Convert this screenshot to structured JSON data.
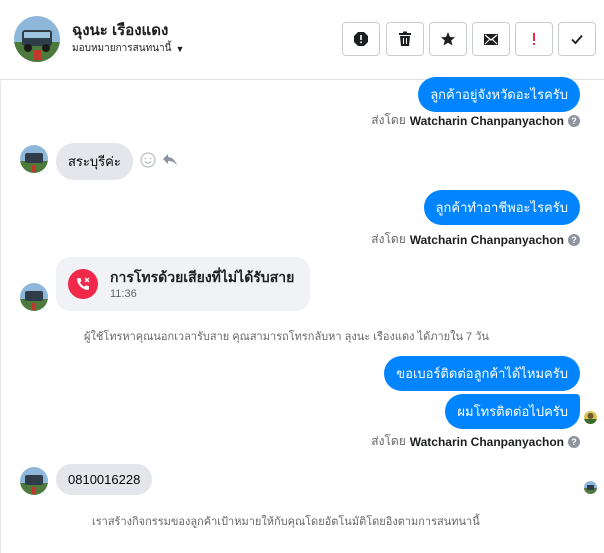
{
  "header": {
    "name": "ฉุงนะ เรืองแดง",
    "assign_label": "มอบหมายการสนทนานี้",
    "actions": [
      "report-icon",
      "trash-icon",
      "star-icon",
      "mark-unread-icon",
      "important-icon",
      "done-icon"
    ]
  },
  "messages": {
    "out_1": "ลูกค้าอยู่จังหวัดอะไรครับ",
    "sentby_prefix": "ส่งโดย",
    "agent_name": "Watcharin Chanpanyachon",
    "in_1": "สระบุรีค่ะ",
    "out_2": "ลูกค้าทำอาชีพอะไรครับ",
    "call_title": "การโทรด้วยเสียงที่ไม่ได้รับสาย",
    "call_time": "11:36",
    "call_notice": "ผู้ใช้โทรหาคุณนอกเวลารับสาย คุณสามารถโทรกลับหา ลุงนะ เรืองแดง ได้ภายใน 7 วัน",
    "out_3": "ขอเบอร์ติดต่อลูกค้าได้ไหมครับ",
    "out_4": "ผมโทรติดต่อไปครับ",
    "in_2": "0810016228",
    "activity_notice": "เราสร้างกิจกรรมของลูกค้าเป้าหมายให้กับคุณโดยอัตโนมัติโดยอิงตามการสนทนานี้"
  },
  "colors": {
    "accent": "#0084ff",
    "missed_call": "#f02849",
    "incoming_bubble": "#e4e6eb"
  }
}
